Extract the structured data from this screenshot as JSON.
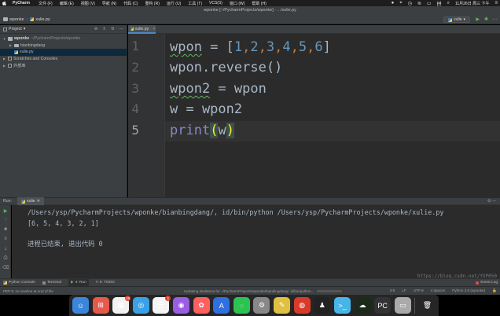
{
  "menubar": {
    "app": "PyCharm",
    "items": [
      "文件 (F)",
      "编辑 (E)",
      "视图 (V)",
      "导航 (N)",
      "代码 (C)",
      "重构 (R)",
      "运行 (U)",
      "工具 (T)",
      "VCS(S)",
      "窗口 (W)",
      "帮助 (H)"
    ],
    "clock": "11月26日 周三 下午"
  },
  "window": {
    "title": "wponke [~/PycharmProjects/wponke] - .../xulie.py"
  },
  "navbar": {
    "project": "wponke",
    "file": "xulie.py",
    "run_config": "xulie"
  },
  "project_pane": {
    "tab_label": "Project",
    "tree": {
      "root_name": "wponke",
      "root_path": "~/PycharmProjects/wponke",
      "folder": "bianbingdang",
      "file": "xulie.py",
      "scratches": "Scratches and Consoles",
      "external_libs": "外部库"
    }
  },
  "editor": {
    "tab_label": "xulie.py",
    "line_numbers": [
      "1",
      "2",
      "3",
      "4",
      "5"
    ],
    "lines": {
      "l1": {
        "var": "wpon",
        "op": " = [",
        "nums": [
          "1",
          "2",
          "3",
          "4",
          "5",
          "6"
        ],
        "close": "]"
      },
      "l2": "wpon.reverse()",
      "l3": {
        "var": "wpon2",
        "rest": " = wpon"
      },
      "l4": "w = wpon2",
      "l5": {
        "func": "print",
        "open": "(",
        "arg": "w",
        "close": ")"
      }
    }
  },
  "run": {
    "label": "Run:",
    "tab_label": "xulie",
    "console": [
      "/Users/ysp/PycharmProjects/wponke/bianbingdang/, id/bin/python /Users/ysp/PycharmProjects/wponke/xulie.py",
      "[6, 5, 4, 3, 2, 1]",
      "",
      "进程已结束, 退出代码 0"
    ],
    "watermark": "https://blog.csdn.net/YSP050"
  },
  "tool_tabs": {
    "python_console": "Python Console",
    "terminal": "Terminal",
    "run": "4: Run",
    "todo": "6: TODO",
    "event_log": "Event Log"
  },
  "status": {
    "pep8": "PEP 8: no newline at end of file",
    "progress_text": "Updating skeletons for ~/PycharmProjects/wponke/bianbingdang/, id/bin/python...",
    "progress": 0.4,
    "position": "5:9",
    "line_sep": "LF",
    "encoding": "UTF-8",
    "indent": "4 spaces",
    "interpreter": "Python 3.6 (wponke)"
  },
  "dock": {
    "mail_badge": "26",
    "chat_badge": "1",
    "colors": [
      "#3b86d9",
      "#e65a4c",
      "#f2f2f2",
      "#3aa1e6",
      "#f4f4f4",
      "#9b5de5",
      "#fe5f5f",
      "#2f6fe0",
      "#2bc352",
      "#888888",
      "#e0c040",
      "#d93b2b",
      "#222222",
      "#46b6e8",
      "#1b2a1b",
      "#333333",
      "#aaaaaa"
    ]
  }
}
